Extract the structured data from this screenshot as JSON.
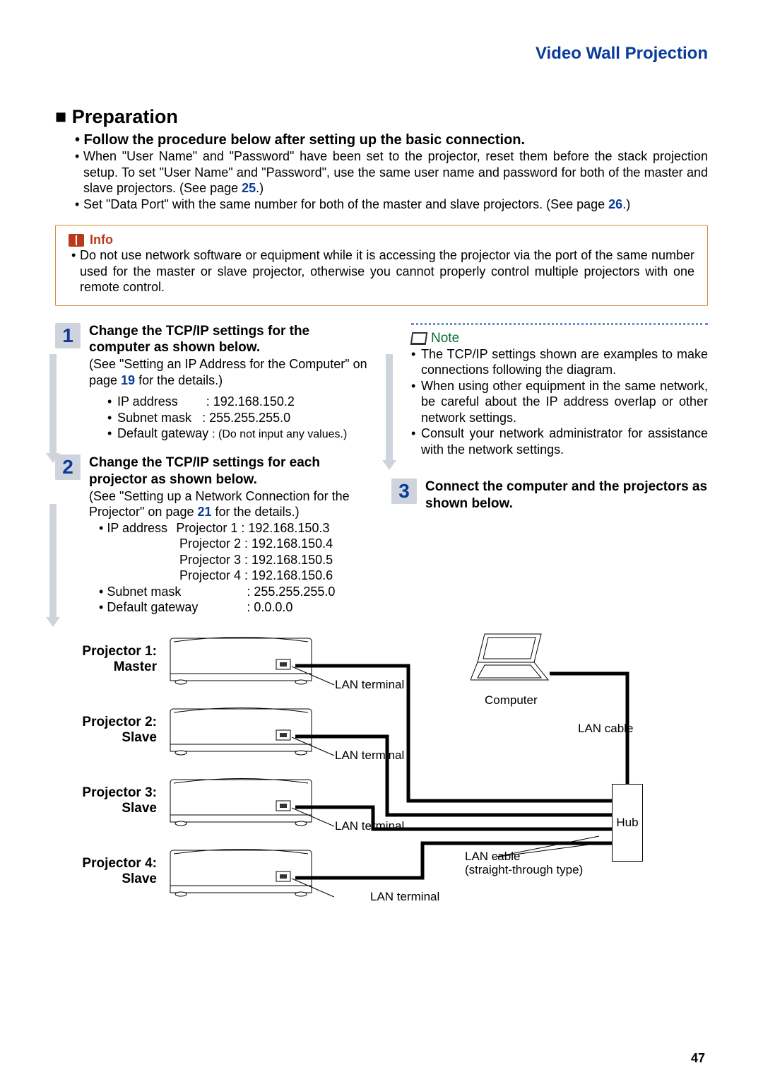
{
  "header": {
    "title": "Video Wall Projection"
  },
  "preparation": {
    "heading": "■ Preparation",
    "subhead": "• Follow the procedure below after setting up the basic connection.",
    "bullets": {
      "b1a": "When \"User Name\" and \"Password\" have been set to the projector, reset them before the stack projection setup. To set \"User Name\" and \"Password\", use the same user name and password for both of the master and slave projectors. (See page ",
      "b1_page": "25",
      "b1b": ".)",
      "b2a": "Set \"Data Port\" with the same number for both of the master and slave projectors. (See page ",
      "b2_page": "26",
      "b2b": ".)"
    }
  },
  "info": {
    "label": "Info",
    "text": "Do not use network software or equipment while it is accessing the projector via the port of the same number used for the master or slave projector, otherwise you cannot properly control multiple projectors with one remote control."
  },
  "steps": {
    "s1": {
      "num": "1",
      "title": "Change the TCP/IP settings for the computer as shown below.",
      "refA": "(See \"Setting an IP Address for the Computer\" on page ",
      "ref_page": "19",
      "refB": " for the details.)",
      "rows": {
        "ip_label": "IP address",
        "ip_val": ": 192.168.150.2",
        "mask_label": "Subnet mask",
        "mask_val": ": 255.255.255.0",
        "gw_label": "Default gateway",
        "gw_val": ": (Do not input any values.)"
      }
    },
    "s2": {
      "num": "2",
      "title": "Change the TCP/IP settings for each projector as shown below.",
      "refA": "(See \"Setting up a Network Connection for the Projector\" on page ",
      "ref_page": "21",
      "refB": " for the details.)",
      "rows": {
        "ip_label": "IP address",
        "p1": "Projector 1 : 192.168.150.3",
        "p2": "Projector 2 : 192.168.150.4",
        "p3": "Projector 3 : 192.168.150.5",
        "p4": "Projector 4 : 192.168.150.6",
        "mask_label": "Subnet mask",
        "mask_val": ": 255.255.255.0",
        "gw_label": "Default gateway",
        "gw_val": ": 0.0.0.0"
      }
    },
    "s3": {
      "num": "3",
      "title": "Connect the computer and the projectors as shown below."
    }
  },
  "note": {
    "label": "Note",
    "items": {
      "n1": "The TCP/IP settings shown are examples to make connections following the diagram.",
      "n2": "When using other equipment in the same network, be careful about the IP address overlap or other network settings.",
      "n3": "Consult your network administrator for assistance with the network settings."
    }
  },
  "diagram": {
    "proj1": "Projector 1: Master",
    "proj2": "Projector 2: Slave",
    "proj3": "Projector 3: Slave",
    "proj4": "Projector 4: Slave",
    "lan_term": "LAN terminal",
    "computer": "Computer",
    "lan_cable": "LAN cable",
    "hub": "Hub",
    "lan_cable2a": "LAN cable",
    "lan_cable2b": "(straight-through type)"
  },
  "page_number": "47"
}
